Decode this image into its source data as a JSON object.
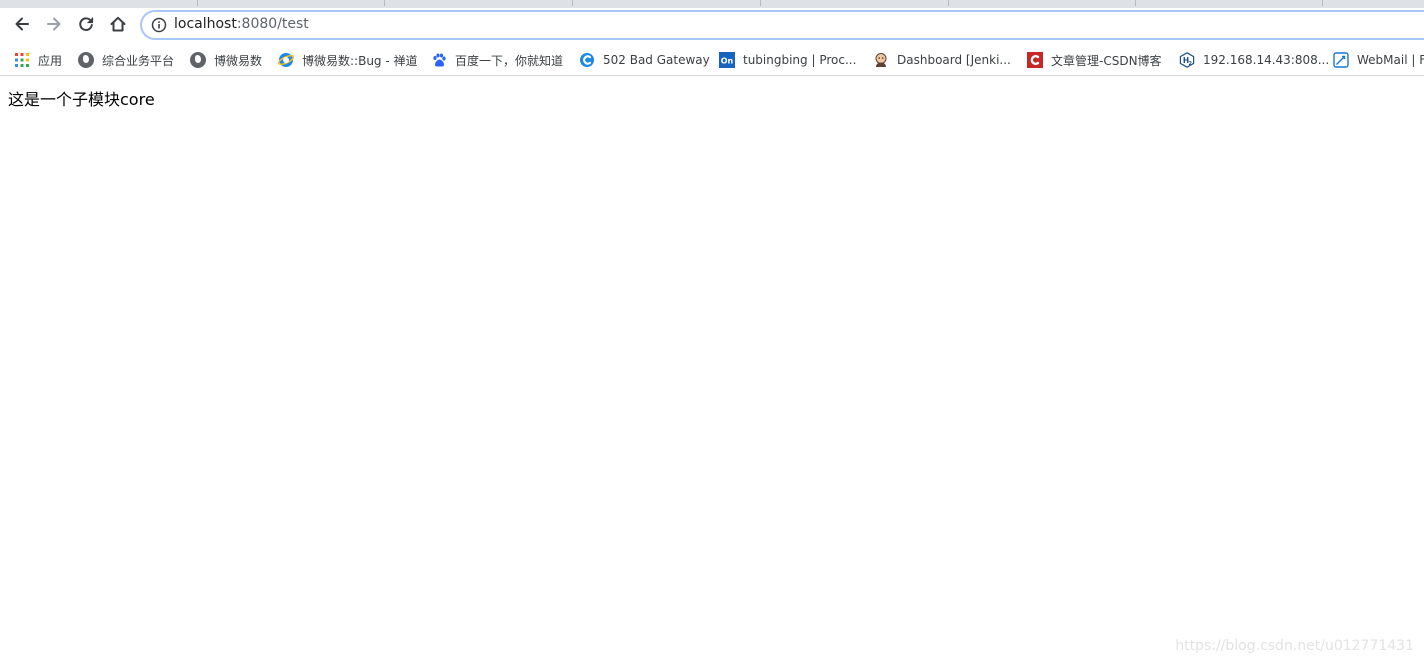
{
  "tabstrip": {},
  "toolbar": {
    "back_icon": "arrow-left-icon",
    "forward_icon": "arrow-right-icon",
    "reload_icon": "reload-icon",
    "home_icon": "home-icon"
  },
  "omnibox": {
    "host": "localhost",
    "rest": ":8080/test",
    "info_icon": "info-circle-icon"
  },
  "bookmarks": [
    {
      "label": "应用",
      "icon": "apps-grid-icon"
    },
    {
      "label": "综合业务平台",
      "icon": "globe-icon"
    },
    {
      "label": "博微易数",
      "icon": "globe-icon"
    },
    {
      "label": "博微易数::Bug - 禅道",
      "icon": "ie-icon"
    },
    {
      "label": "百度一下，你就知道",
      "icon": "baidu-paw-icon"
    },
    {
      "label": "502 Bad Gateway",
      "icon": "c-logo-icon"
    },
    {
      "label": "tubingbing | Proc...",
      "icon": "on-logo-icon"
    },
    {
      "label": "Dashboard [Jenki...",
      "icon": "jenkins-icon"
    },
    {
      "label": "文章管理-CSDN博客",
      "icon": "csdn-icon"
    },
    {
      "label": "192.168.14.43:808...",
      "icon": "h2-icon"
    },
    {
      "label": "WebMail | F",
      "icon": "webmail-icon"
    }
  ],
  "page": {
    "body_text": "这是一个子模块core"
  },
  "watermark": {
    "text": "https://blog.csdn.net/u012771431"
  }
}
